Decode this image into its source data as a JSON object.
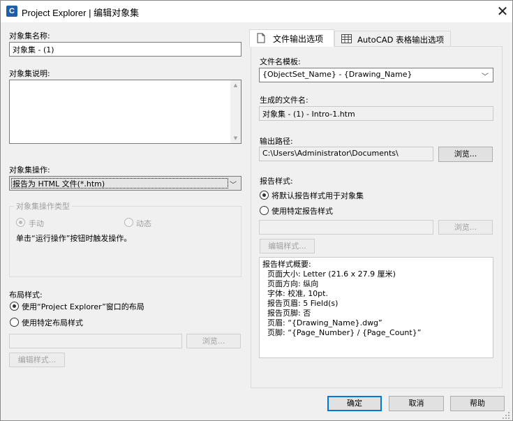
{
  "window": {
    "title": "Project Explorer | 编辑对象集",
    "close_glyph": "✕"
  },
  "left": {
    "name_label": "对象集名称:",
    "name_value": "对象集 - (1)",
    "desc_label": "对象集说明:",
    "desc_value": "",
    "op_label": "对象集操作:",
    "op_value": "报告为 HTML 文件(*.htm)",
    "optype_group": "对象集操作类型",
    "optype_manual": "手动",
    "optype_dynamic": "动态",
    "optype_hint": "单击“运行操作”按钮时触发操作。",
    "layout_label": "布局样式:",
    "layout_opt1": "使用“Project Explorer”窗口的布局",
    "layout_opt2": "使用特定布局样式",
    "layout_path": "",
    "browse": "浏览...",
    "edit_style": "编辑样式..."
  },
  "tabs": {
    "file_output": "文件输出选项",
    "autocad_table": "AutoCAD 表格输出选项"
  },
  "right": {
    "template_label": "文件名模板:",
    "template_value": "{ObjectSet_Name} - {Drawing_Name}",
    "generated_label": "生成的文件名:",
    "generated_value": "对象集 - (1) - Intro-1.htm",
    "path_label": "输出路径:",
    "path_value": "C:\\Users\\Administrator\\Documents\\",
    "browse": "浏览...",
    "style_label": "报告样式:",
    "style_opt1": "将默认报告样式用于对象集",
    "style_opt2": "使用特定报告样式",
    "style_path": "",
    "browse2": "浏览...",
    "edit_style": "编辑样式...",
    "summary": [
      "报告样式概要:",
      "  页面大小: Letter (21.6 x 27.9 厘米)",
      "  页面方向: 纵向",
      "  字体: 校准, 10pt.",
      "  报告页眉: 5 Field(s)",
      "  报告页脚: 否",
      "  页眉: “{Drawing_Name}.dwg”",
      "  页脚: “{Page_Number} / {Page_Count}”"
    ]
  },
  "footer": {
    "ok": "确定",
    "cancel": "取消",
    "help": "帮助"
  }
}
